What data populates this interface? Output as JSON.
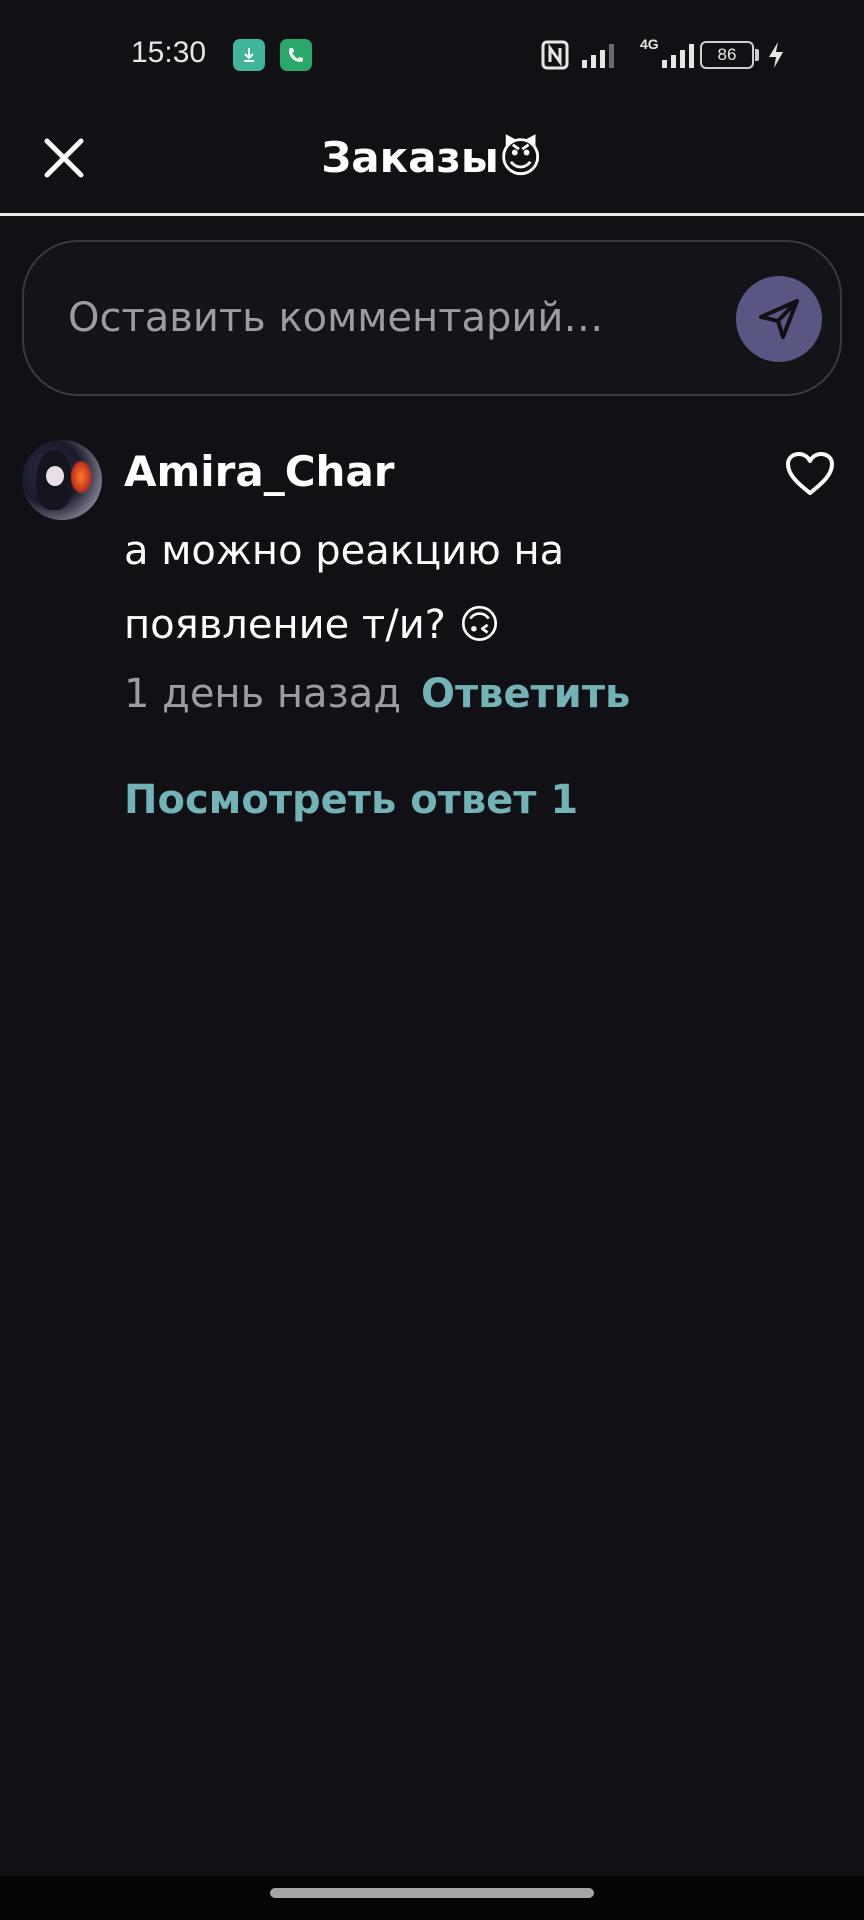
{
  "status_bar": {
    "time": "15:30",
    "network_label": "4G",
    "battery_level": "86",
    "icons": [
      "download-icon",
      "phone-icon",
      "nfc-icon",
      "signal-icon",
      "signal-icon",
      "battery-icon",
      "charging-icon"
    ]
  },
  "header": {
    "title": "Заказы😈",
    "close_icon": "close-icon"
  },
  "comment_input": {
    "placeholder": "Оставить комментарий…",
    "value": "",
    "send_icon": "send-icon"
  },
  "comments": [
    {
      "username": "Amira_Char",
      "text": "а можно реакцию на появление т/и? 🙃",
      "timestamp": "1 день назад",
      "reply_label": "Ответить",
      "view_replies_label": "Посмотреть ответ 1",
      "like_icon": "heart-icon"
    }
  ],
  "colors": {
    "background": "#111014",
    "accent": "#72b3b8",
    "send_button": "#5a5683",
    "muted_text": "#9d9ca3"
  }
}
